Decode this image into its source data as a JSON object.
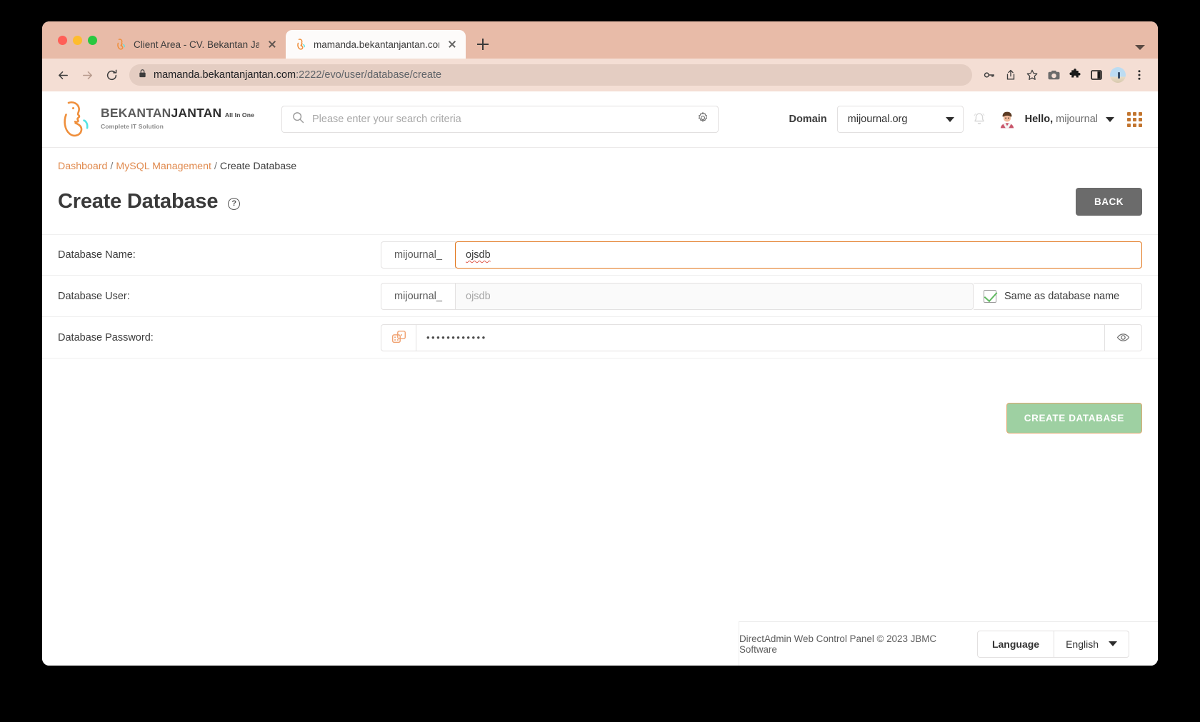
{
  "browser": {
    "tabs": [
      {
        "title": "Client Area - CV. Bekantan Jan",
        "active": false
      },
      {
        "title": "mamanda.bekantanjantan.com",
        "active": true
      }
    ],
    "url_main": "mamanda.bekantanjantan.com",
    "url_rest": ":2222/evo/user/database/create",
    "new_tab_label": "+"
  },
  "header": {
    "brand_part1": "BEKANTAN",
    "brand_part2": "JANTAN",
    "brand_tagline_bold": "All In One",
    "brand_tagline_rest": "Complete IT Solution",
    "search_placeholder": "Please enter your search criteria",
    "domain_label": "Domain",
    "domain_value": "mijournal.org",
    "greeting_bold": "Hello,",
    "greeting_user": "mijournal"
  },
  "breadcrumb": {
    "item1": "Dashboard",
    "item2": "MySQL Management",
    "item3": "Create Database",
    "separator": "/"
  },
  "main": {
    "title": "Create Database",
    "help_glyph": "?",
    "back_label": "BACK",
    "submit_label": "CREATE DATABASE",
    "fields": {
      "db_name": {
        "label": "Database Name:",
        "prefix": "mijournal_",
        "value": "ojsdb"
      },
      "db_user": {
        "label": "Database User:",
        "prefix": "mijournal_",
        "value": "ojsdb",
        "checkbox_label": "Same as database name"
      },
      "db_password": {
        "label": "Database Password:",
        "value": "••••••••••••"
      }
    }
  },
  "footer": {
    "copyright": "DirectAdmin Web Control Panel © 2023 JBMC Software",
    "language_label": "Language",
    "language_value": "English"
  },
  "colors": {
    "accent_orange": "#e08a4e",
    "focus_orange": "#e2761b",
    "submit_green": "#9ed0a2",
    "back_grey": "#6b6b6b",
    "browser_chrome": "#e8bba8"
  }
}
